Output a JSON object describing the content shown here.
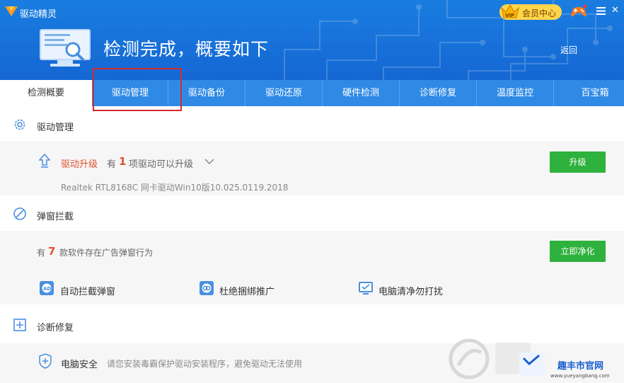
{
  "app": {
    "title": "驱动精灵"
  },
  "header": {
    "vip_label": "会员中心",
    "hero_title": "检测完成，概要如下",
    "back_label": "返回"
  },
  "tabs": [
    {
      "label": "检测概要",
      "active": true
    },
    {
      "label": "驱动管理",
      "active": false
    },
    {
      "label": "驱动备份",
      "active": false
    },
    {
      "label": "驱动还原",
      "active": false
    },
    {
      "label": "硬件检测",
      "active": false
    },
    {
      "label": "诊断修复",
      "active": false
    },
    {
      "label": "温度监控",
      "active": false
    },
    {
      "label": "百宝箱",
      "active": false
    }
  ],
  "driver_section": {
    "title": "驱动管理",
    "upgrade_label": "驱动升级",
    "upgrade_prefix": "有",
    "upgrade_count": "1",
    "upgrade_suffix": "项驱动可以升级",
    "driver_name": "Realtek RTL8168C 网卡驱动Win10版10.025.0119.2018",
    "upgrade_button": "升级"
  },
  "popup_section": {
    "title": "弹窗拦截",
    "prefix": "有",
    "count": "7",
    "suffix": "款软件存在广告弹窗行为",
    "clean_button": "立即净化",
    "features": [
      "自动拦截弹窗",
      "杜绝捆绑推广",
      "电脑清净勿打扰"
    ]
  },
  "diag_section": {
    "title": "诊断修复",
    "safety_label": "电脑安全",
    "safety_desc": "请您安装毒霸保护驱动安装程序，避免驱动无法使用"
  },
  "watermark": {
    "text": "趣丰市官网",
    "url": "www.yueyangbang.com"
  },
  "colors": {
    "accent": "#1a7de0",
    "tab_bar": "#2f8ae6",
    "warning": "#e0502f",
    "action": "#2fb13d",
    "highlight_box": "#d62c2c"
  }
}
